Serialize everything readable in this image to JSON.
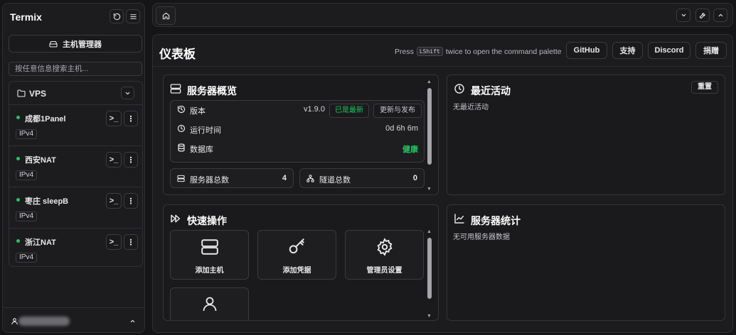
{
  "sidebar": {
    "brand": "Termix",
    "host_manager_label": "主机管理器",
    "search_placeholder": "按任意信息搜索主机...",
    "group": {
      "name": "VPS",
      "hosts": [
        {
          "name": "成都1Panel",
          "tag": "IPv4",
          "status": "online"
        },
        {
          "name": "西安NAT",
          "tag": "IPv4",
          "status": "online"
        },
        {
          "name": "枣庄 sleepB",
          "tag": "IPv4",
          "status": "online"
        },
        {
          "name": "浙江NAT",
          "tag": "IPv4",
          "status": "online"
        }
      ]
    }
  },
  "header": {
    "title": "仪表板",
    "hint_pre": "Press",
    "hint_key": "LShift",
    "hint_post": "twice to open the command palette",
    "buttons": {
      "github": "GitHub",
      "support": "支持",
      "discord": "Discord",
      "donate": "捐赠"
    }
  },
  "server_overview": {
    "title": "服务器概览",
    "version_label": "版本",
    "version_value": "v1.9.0",
    "version_badge": "已是最新",
    "update_button": "更新与发布",
    "uptime_label": "运行时间",
    "uptime_value": "0d 6h 6m",
    "db_label": "数据库",
    "db_value": "健康",
    "total_servers_label": "服务器总数",
    "total_servers_value": "4",
    "total_tunnels_label": "隧道总数",
    "total_tunnels_value": "0"
  },
  "recent_activity": {
    "title": "最近活动",
    "reset_label": "重置",
    "empty_text": "无最近活动"
  },
  "quick_actions": {
    "title": "快速操作",
    "items": [
      {
        "label": "添加主机",
        "icon": "server-icon"
      },
      {
        "label": "添加凭据",
        "icon": "key-icon"
      },
      {
        "label": "管理员设置",
        "icon": "gear-icon"
      },
      {
        "label": "",
        "icon": "user-icon"
      }
    ]
  },
  "server_stats": {
    "title": "服务器统计",
    "empty_text": "无可用服务器数据"
  },
  "colors": {
    "background": "#151517",
    "panel": "#1c1c1f",
    "status_online": "#22c55e",
    "healthy": "#22c55e"
  }
}
